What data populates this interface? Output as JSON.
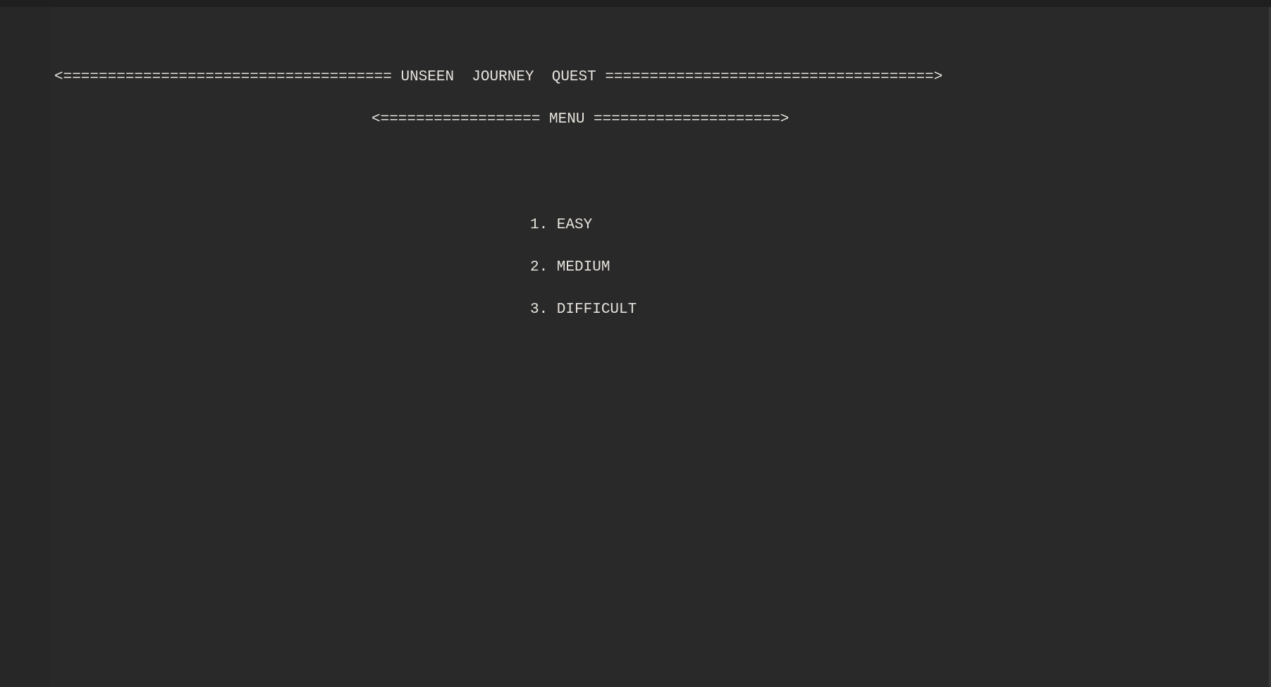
{
  "title_banner": "<===================================== UNSEEN  JOURNEY  QUEST =====================================>",
  "menu_banner": "<================== MENU =====================>",
  "menu": {
    "options": [
      "1. EASY",
      "2. MEDIUM",
      "3. DIFFICULT"
    ]
  },
  "colors": {
    "background": "#2a292a",
    "text": "#e6e3dc"
  }
}
